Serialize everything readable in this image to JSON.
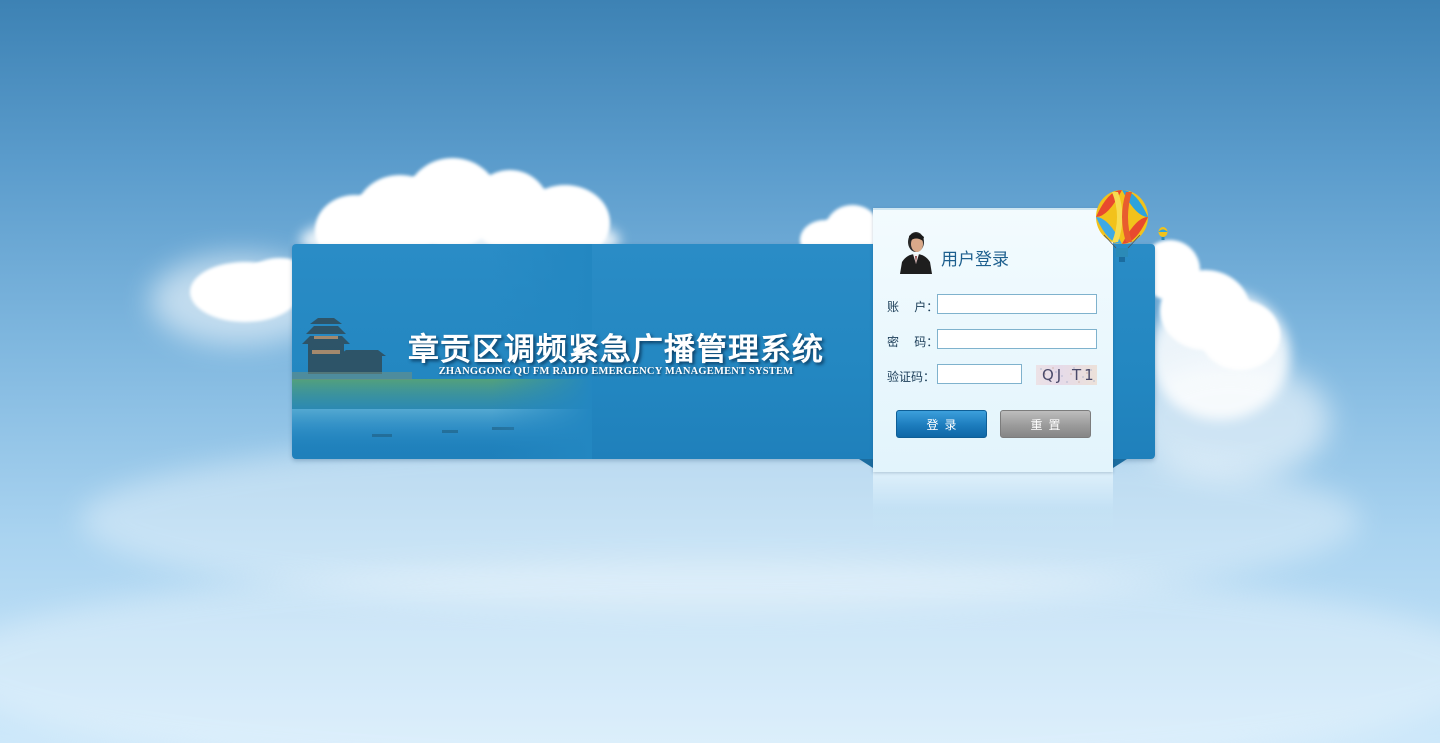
{
  "banner": {
    "title": "章贡区调频紧急广播管理系统",
    "subtitle": "ZHANGGONG QU FM RADIO EMERGENCY MANAGEMENT SYSTEM"
  },
  "login": {
    "title": "用户登录",
    "account_label": "账    户：",
    "account_value": "",
    "password_label": "密    码：",
    "password_value": "",
    "captcha_label": "验证码：",
    "captcha_value": "",
    "captcha_text": "QJ T1",
    "login_button": "登录",
    "reset_button": "重置"
  },
  "colors": {
    "sky_top": "#3d82b4",
    "sky_bottom": "#cde8fa",
    "banner": "#2387c1",
    "login_button": "#1c7cbd",
    "reset_button": "#9b9b9b",
    "title_text": "#1d5f8e"
  },
  "icons": {
    "avatar": "user-avatar-icon",
    "balloon": "hot-air-balloon-icon"
  }
}
